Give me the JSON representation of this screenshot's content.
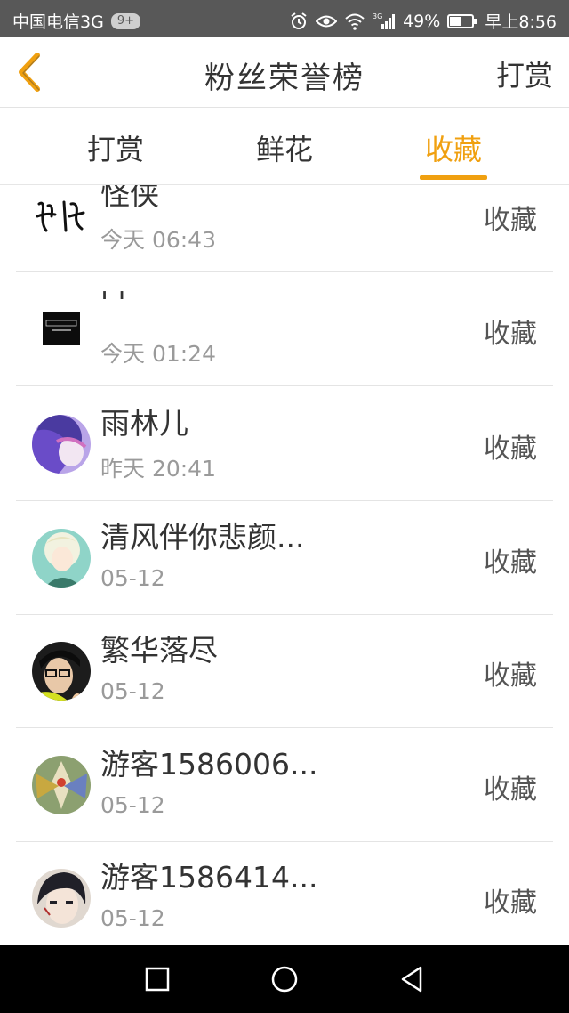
{
  "status_bar": {
    "carrier": "中国电信3G",
    "badge": "9+",
    "battery": "49%",
    "time": "早上8:56"
  },
  "header": {
    "title": "粉丝荣誉榜",
    "action": "打赏"
  },
  "tabs": [
    {
      "label": "打赏",
      "active": false
    },
    {
      "label": "鲜花",
      "active": false
    },
    {
      "label": "收藏",
      "active": true
    }
  ],
  "accent_color": "#f0a010",
  "list": [
    {
      "name": "怪侠",
      "time": "今天 06:43",
      "action": "收藏",
      "avatar_icon": "calligraphy-avatar-icon"
    },
    {
      "name": "' '",
      "time": "今天 01:24",
      "action": "收藏",
      "avatar_icon": "black-square-avatar-icon"
    },
    {
      "name": "雨林儿",
      "time": "昨天 20:41",
      "action": "收藏",
      "avatar_icon": "purple-anime-avatar-icon"
    },
    {
      "name": "清风伴你悲颜...",
      "time": "05-12",
      "action": "收藏",
      "avatar_icon": "green-anime-avatar-icon"
    },
    {
      "name": "繁华落尽",
      "time": "05-12",
      "action": "收藏",
      "avatar_icon": "person-glasses-avatar-icon"
    },
    {
      "name": "游客1586006...",
      "time": "05-12",
      "action": "收藏",
      "avatar_icon": "mecha-avatar-icon"
    },
    {
      "name": "游客1586414...",
      "time": "05-12",
      "action": "收藏",
      "avatar_icon": "dark-anime-avatar-icon"
    }
  ],
  "nav_bar": {
    "icons": [
      "recent-apps-icon",
      "home-icon",
      "back-icon"
    ]
  }
}
